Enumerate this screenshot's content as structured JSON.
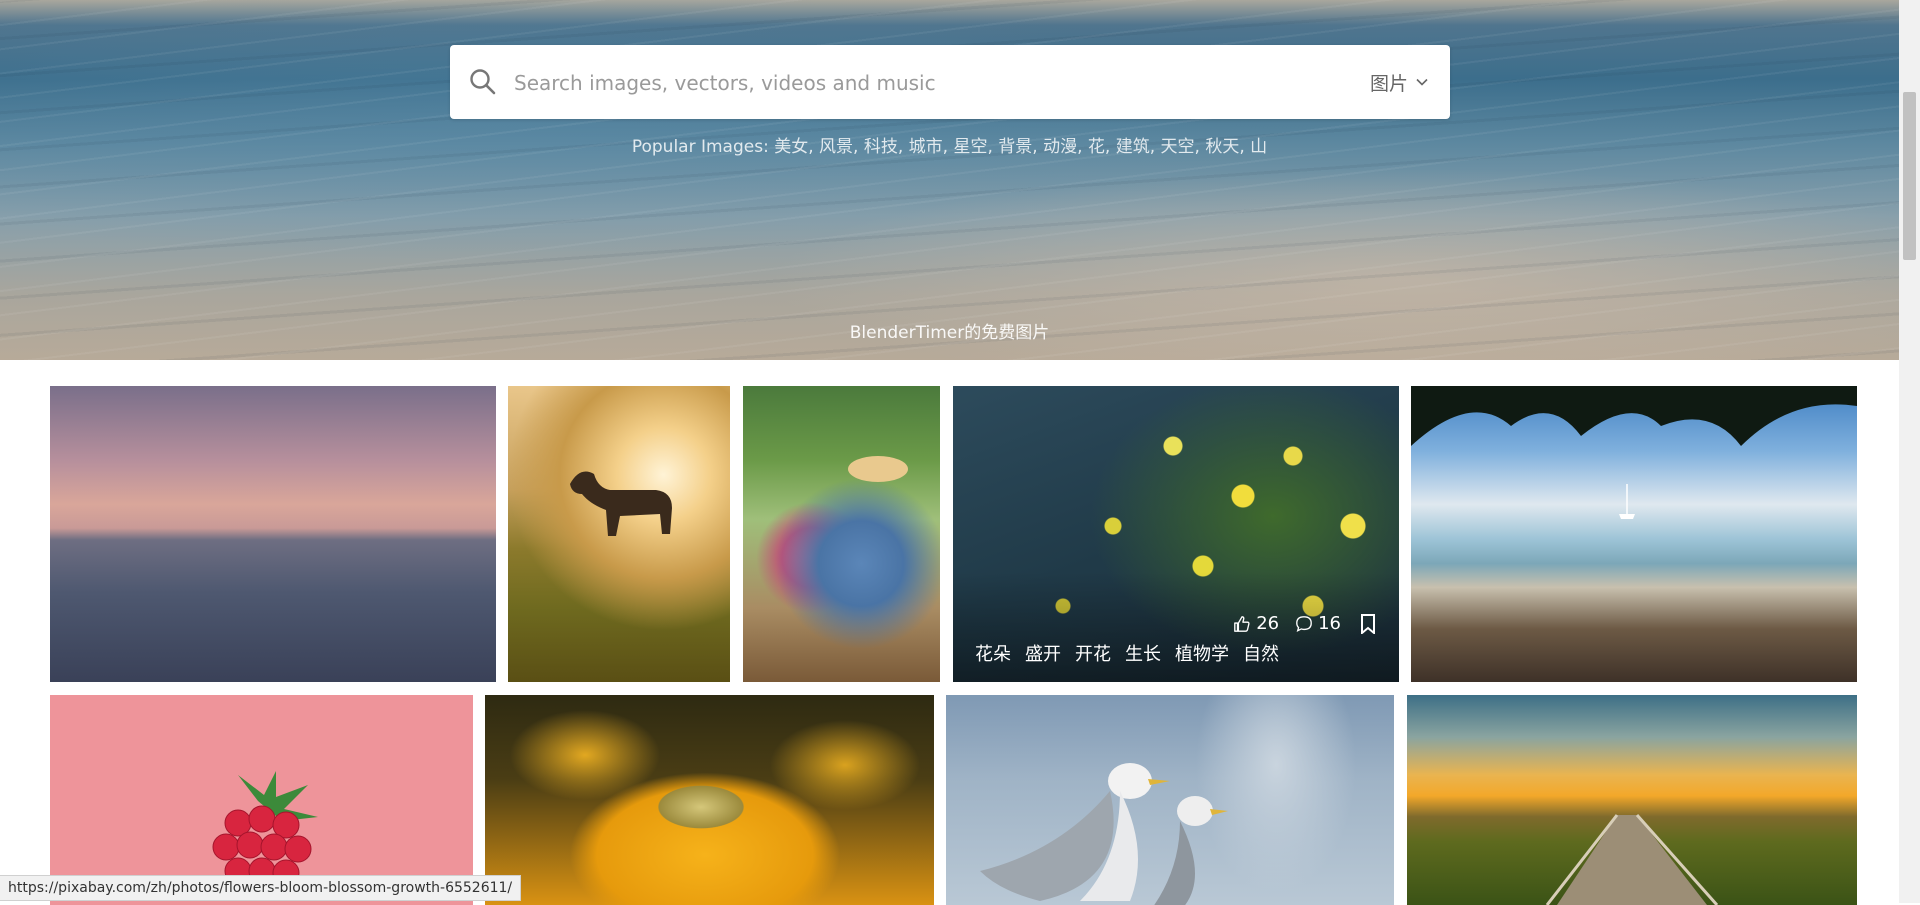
{
  "search": {
    "placeholder": "Search images, vectors, videos and music",
    "type_label": "图片"
  },
  "popular": {
    "prefix": "Popular Images:",
    "terms": [
      "美女",
      "风景",
      "科技",
      "城市",
      "星空",
      "背景",
      "动漫",
      "花",
      "建筑",
      "天空",
      "秋天",
      "山"
    ]
  },
  "hero": {
    "credit": "BlenderTimer的免费图片"
  },
  "hovered_photo": {
    "likes": "26",
    "comments": "16",
    "tags": [
      "花朵",
      "盛开",
      "开花",
      "生长",
      "植物学",
      "自然"
    ]
  },
  "status_url": "https://pixabay.com/zh/photos/flowers-bloom-blossom-growth-6552611/",
  "colors": {
    "accent": "#ffffff",
    "placeholder": "#9a9a9a"
  }
}
